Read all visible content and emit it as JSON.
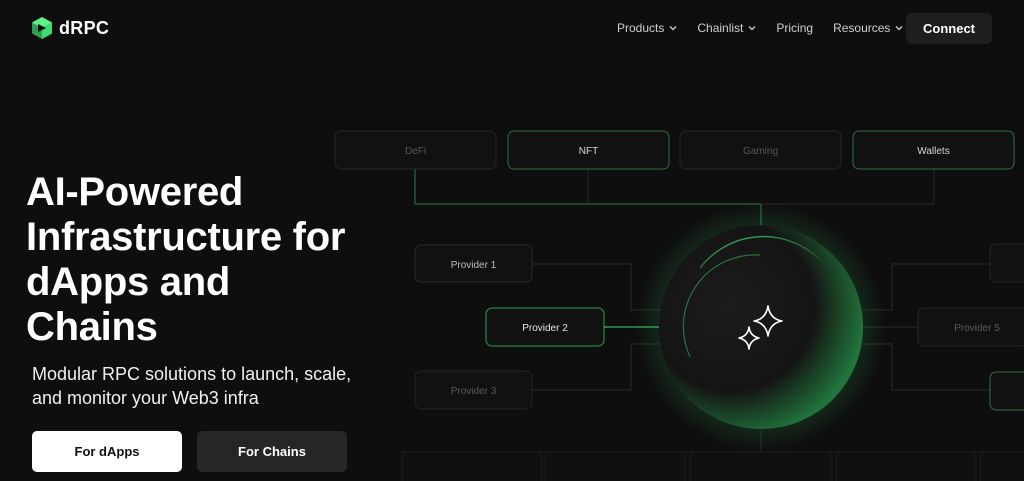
{
  "brand": {
    "name": "dRPC",
    "accent": "#3ddc6e"
  },
  "nav": {
    "items": [
      {
        "label": "Products",
        "has_dropdown": true
      },
      {
        "label": "Chainlist",
        "has_dropdown": true
      },
      {
        "label": "Pricing",
        "has_dropdown": false
      },
      {
        "label": "Resources",
        "has_dropdown": true
      }
    ],
    "connect_label": "Connect"
  },
  "hero": {
    "title": "AI-Powered Infrastructure for dApps and Chains",
    "subtitle": "Modular RPC solutions to launch, scale, and monitor your Web3 infra",
    "primary_button": "For dApps",
    "secondary_button": "For Chains"
  },
  "diagram": {
    "categories": [
      "DeFi",
      "NFT",
      "Gaming",
      "Wallets"
    ],
    "providers": [
      "Provider 1",
      "Provider 2",
      "Provider 3",
      "Provider 5"
    ],
    "center_icon": "sparkles-icon"
  }
}
